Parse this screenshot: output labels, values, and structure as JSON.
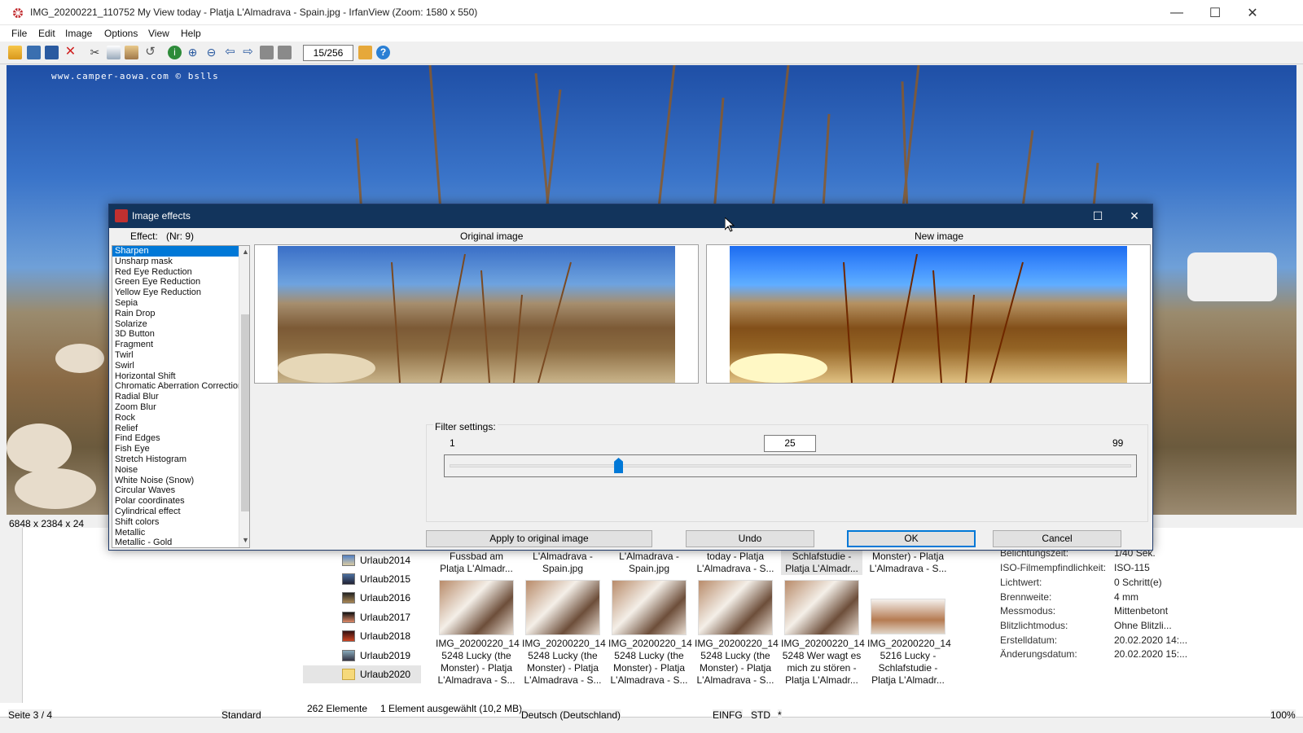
{
  "window": {
    "title": "IMG_20200221_110752 My View today - Platja L'Almadrava - Spain.jpg - IrfanView (Zoom: 1580 x 550)",
    "minimize": "—",
    "maximize": "☐",
    "close": "✕"
  },
  "menu": [
    "File",
    "Edit",
    "Image",
    "Options",
    "View",
    "Help"
  ],
  "toolbar": {
    "counter": "15/256",
    "icons": [
      "open-icon",
      "thumbnails-icon",
      "save-icon",
      "delete-icon",
      "cut-icon",
      "copy-icon",
      "paste-icon",
      "undo-icon",
      "info-icon",
      "zoom-in-icon",
      "zoom-out-icon",
      "prev-icon",
      "next-icon",
      "first-icon",
      "last-icon",
      "paint-icon",
      "help-icon"
    ]
  },
  "image": {
    "watermark": "www.camper-aowa.com © bslls",
    "dimensions": "6848 x 2384 x 24 BPP"
  },
  "dialog": {
    "title": "Image effects",
    "effect_label": "Effect:",
    "effect_nr": "(Nr: 9)",
    "original_label": "Original image",
    "new_label": "New image",
    "effects": [
      "Sharpen",
      "Unsharp mask",
      "Red Eye Reduction",
      "Green Eye Reduction",
      "Yellow Eye Reduction",
      "Sepia",
      "Rain Drop",
      "Solarize",
      "3D Button",
      "Fragment",
      "Twirl",
      "Swirl",
      "Horizontal Shift",
      "Chromatic Aberration Correction",
      "Radial Blur",
      "Zoom Blur",
      "Rock",
      "Relief",
      "Find Edges",
      "Fish Eye",
      "Stretch Histogram",
      "Noise",
      "White Noise (Snow)",
      "Circular Waves",
      "Polar coordinates",
      "Cylindrical effect",
      "Shift colors",
      "Metallic",
      "Metallic - Gold"
    ],
    "selected_effect": "Sharpen",
    "filter_settings_label": "Filter settings:",
    "min": "1",
    "max": "99",
    "value": "25",
    "slider_fraction": 0.2474,
    "buttons": {
      "apply": "Apply to original image",
      "undo": "Undo",
      "ok": "OK",
      "cancel": "Cancel"
    },
    "maximize": "☐",
    "close": "✕"
  },
  "explorer": {
    "folders": [
      "Urlaub2014",
      "Urlaub2015",
      "Urlaub2016",
      "Urlaub2017",
      "Urlaub2018",
      "Urlaub2019",
      "Urlaub2020"
    ],
    "top_captions": [
      "Fussbad am\nPlatja L'Almadr...",
      "L'Almadrava -\nSpain.jpg",
      "L'Almadrava -\nSpain.jpg",
      "today - Platja\nL'Almadrava - S...",
      "Schlafstudie -\nPlatja L'Almadr...",
      "Monster) - Platja\nL'Almadrava - S..."
    ],
    "captions": [
      "IMG_20200220_14\n5248 Lucky (the\nMonster) - Platja\nL'Almadrava - S...",
      "IMG_20200220_14\n5248 Lucky (the\nMonster) - Platja\nL'Almadrava - S...",
      "IMG_20200220_14\n5248 Lucky (the\nMonster) - Platja\nL'Almadrava - S...",
      "IMG_20200220_14\n5248 Lucky (the\nMonster) - Platja\nL'Almadrava - S...",
      "IMG_20200220_14\n5248 Wer wagt es\nmich zu stören -\nPlatja L'Almadr...",
      "IMG_20200220_14\n5216 Lucky -\nSchlafstudie -\nPlatja L'Almadr..."
    ],
    "item_count": "262 Elemente",
    "selection": "1 Element ausgewählt (10,2 MB)",
    "properties": [
      {
        "k": "Belichtungszeit:",
        "v": "1/40 Sek."
      },
      {
        "k": "ISO-Filmempfindlichkeit:",
        "v": "ISO-115"
      },
      {
        "k": "Lichtwert:",
        "v": "0 Schritt(e)"
      },
      {
        "k": "Brennweite:",
        "v": "4 mm"
      },
      {
        "k": "Messmodus:",
        "v": "Mittenbetont"
      },
      {
        "k": "Blitzlichtmodus:",
        "v": "Ohne Blitzli..."
      },
      {
        "k": "Erstelldatum:",
        "v": "20.02.2020 14:..."
      },
      {
        "k": "Änderungsdatum:",
        "v": "20.02.2020 15:..."
      }
    ]
  },
  "statusbar": {
    "page": "Seite 3 / 4",
    "style": "Standard",
    "language": "Deutsch (Deutschland)",
    "insert": "EINFG",
    "std": "STD",
    "star": "*",
    "zoom": "100%"
  }
}
